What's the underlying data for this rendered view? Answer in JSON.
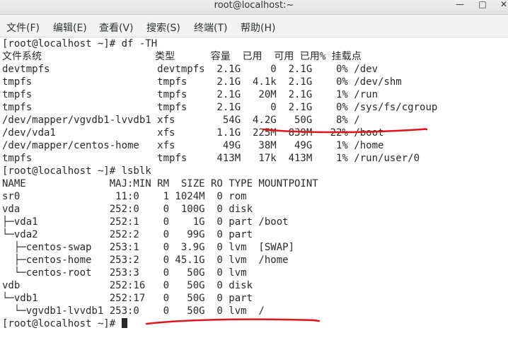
{
  "window": {
    "title": "root@localhost:~",
    "minimize_glyph": "—",
    "maximize_glyph": "□",
    "close_glyph": "✕"
  },
  "menu": {
    "items": [
      "文件(F)",
      "编辑(E)",
      "查看(V)",
      "搜索(S)",
      "终端(T)",
      "帮助(H)"
    ]
  },
  "terminal": {
    "lines": [
      "[root@localhost ~]# df -TH",
      "文件系统                   类型      容量  已用  可用 已用% 挂载点",
      "devtmpfs                  devtmpfs  2.1G     0  2.1G    0% /dev",
      "tmpfs                     tmpfs     2.1G  4.1k  2.1G    0% /dev/shm",
      "tmpfs                     tmpfs     2.1G   20M  2.1G    1% /run",
      "tmpfs                     tmpfs     2.1G     0  2.1G    0% /sys/fs/cgroup",
      "/dev/mapper/vgvdb1-lvvdb1 xfs        54G  4.2G   50G    8% /",
      "/dev/vda1                 xfs       1.1G  225M  839M   22% /boot",
      "/dev/mapper/centos-home   xfs        49G   38M   49G    1% /home",
      "tmpfs                     tmpfs     413M   17k  413M    1% /run/user/0",
      "[root@localhost ~]# lsblk",
      "NAME              MAJ:MIN RM  SIZE RO TYPE MOUNTPOINT",
      "sr0                11:0    1 1024M  0 rom",
      "vda               252:0    0  100G  0 disk",
      "├─vda1            252:1    0    1G  0 part /boot",
      "└─vda2            252:2    0   99G  0 part",
      "  ├─centos-swap   253:1    0  3.9G  0 lvm  [SWAP]",
      "  ├─centos-home   253:2    0 45.1G  0 lvm  /home",
      "  └─centos-root   253:3    0   50G  0 lvm",
      "vdb               252:16   0   50G  0 disk",
      "└─vdb1            252:17   0   50G  0 part",
      "  └─vgvdb1-lvvdb1 253:0    0   50G  0 lvm  /",
      "[root@localhost ~]# "
    ]
  },
  "annotation_color": "#e0141c"
}
